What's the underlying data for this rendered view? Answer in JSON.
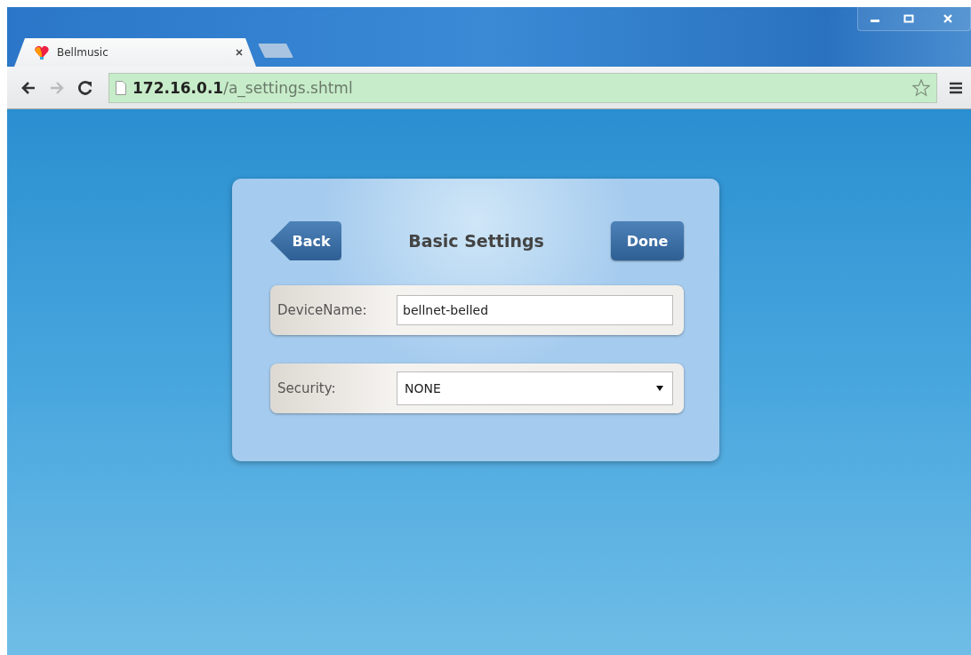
{
  "browser": {
    "tabs": [
      {
        "title": "Bellmusic",
        "selected": true
      }
    ],
    "address": "**172.16.0.1**/a_settings.shtml",
    "bookmarked": false
  },
  "page": {
    "title": "Basic Settings",
    "back_button": "Back",
    "done_button": "Done",
    "fields": [
      {
        "kind": "text",
        "label": "DeviceName:",
        "value": "bellnet-belled"
      },
      {
        "kind": "select",
        "label": "Security:",
        "value": "NONE"
      }
    ]
  }
}
